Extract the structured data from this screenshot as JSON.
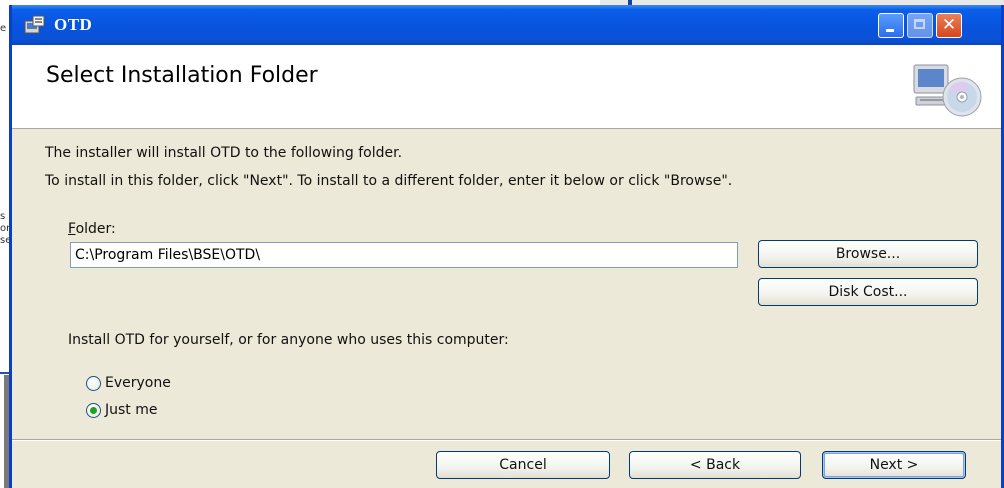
{
  "window": {
    "title": "OTD",
    "minimize_label": "minimize",
    "maximize_label": "maximize",
    "close_glyph": "✕"
  },
  "header": {
    "title": "Select Installation Folder",
    "icon": "computer-cd-icon"
  },
  "body": {
    "intro_line1": "The installer will install OTD to the following folder.",
    "intro_line2": "To install in this folder, click \"Next\". To install to a different folder, enter it below or click \"Browse\".",
    "folder_label_access": "F",
    "folder_label_rest": "older:",
    "folder_value": "C:\\Program Files\\BSE\\OTD\\",
    "browse_label": "Browse...",
    "disk_cost_label": "Disk Cost...",
    "scope_question": "Install OTD for yourself, or for anyone who uses this computer:",
    "options": [
      {
        "label": "Everyone",
        "selected": false
      },
      {
        "label": "Just me",
        "selected": true
      }
    ]
  },
  "footer": {
    "cancel_label": "Cancel",
    "back_label": "< Back",
    "next_label": "Next >"
  },
  "background": {
    "left_fragments": [
      "e",
      "s",
      "on",
      "se"
    ]
  },
  "colors": {
    "titlebar": "#0854e0",
    "dialog_bg": "#ece9d8",
    "radio_dot": "#21a121",
    "button_border": "#003c74"
  }
}
